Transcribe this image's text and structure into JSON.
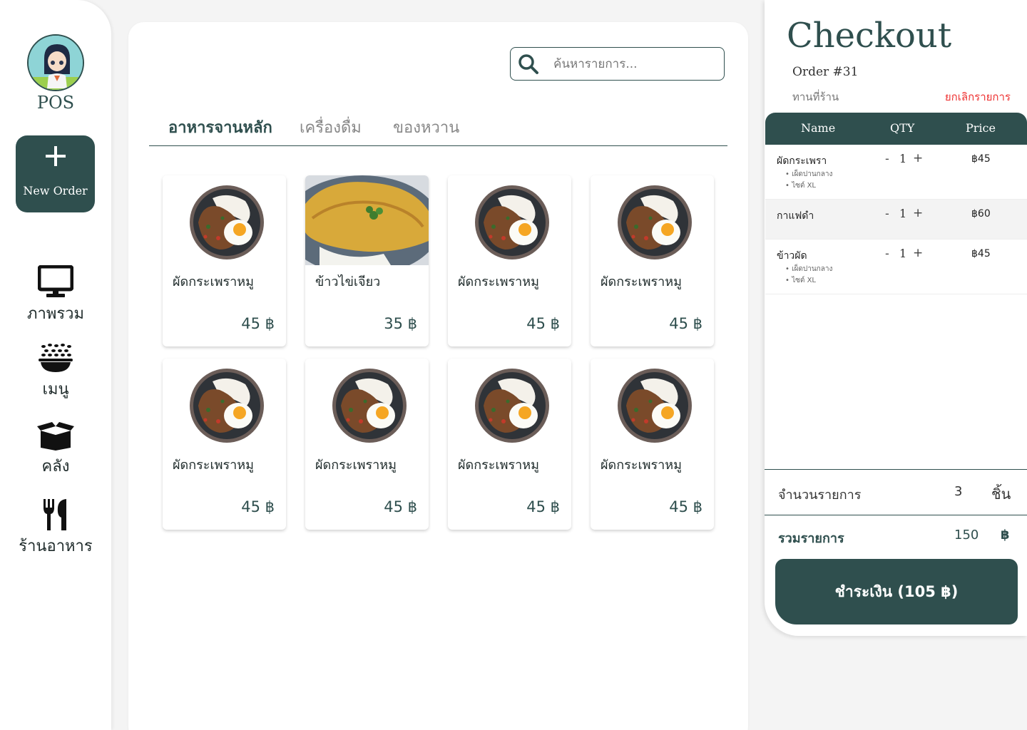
{
  "app": {
    "brand": "POS"
  },
  "sidebar": {
    "new_order_label": "New Order",
    "items": [
      {
        "label": "ภาพรวม",
        "icon": "monitor-icon"
      },
      {
        "label": "เมนู",
        "icon": "rice-bowl-icon"
      },
      {
        "label": "คลัง",
        "icon": "box-icon"
      },
      {
        "label": "ร้านอาหาร",
        "icon": "fork-knife-icon"
      }
    ]
  },
  "search": {
    "placeholder": "ค้นหารายการ..."
  },
  "tabs": [
    {
      "label": "อาหารจานหลัก",
      "active": true
    },
    {
      "label": "เครื่องดื่ม",
      "active": false
    },
    {
      "label": "ของหวาน",
      "active": false
    }
  ],
  "menu_items": [
    {
      "name": "ผัดกระเพราหมู",
      "price": "45 ฿",
      "image": "basil-pork-rice"
    },
    {
      "name": "ข้าวไข่เจียว",
      "price": "35 ฿",
      "image": "omelette-rice"
    },
    {
      "name": "ผัดกระเพราหมู",
      "price": "45 ฿",
      "image": "basil-pork-rice"
    },
    {
      "name": "ผัดกระเพราหมู",
      "price": "45 ฿",
      "image": "basil-pork-rice"
    },
    {
      "name": "ผัดกระเพราหมู",
      "price": "45 ฿",
      "image": "basil-pork-rice"
    },
    {
      "name": "ผัดกระเพราหมู",
      "price": "45 ฿",
      "image": "basil-pork-rice"
    },
    {
      "name": "ผัดกระเพราหมู",
      "price": "45 ฿",
      "image": "basil-pork-rice"
    },
    {
      "name": "ผัดกระเพราหมู",
      "price": "45 ฿",
      "image": "basil-pork-rice"
    }
  ],
  "checkout": {
    "title": "Checkout",
    "order_no": "Order #31",
    "dine_type": "ทานที่ร้าน",
    "cancel_label": "ยกเลิกรายการ",
    "columns": {
      "name": "Name",
      "qty": "QTY",
      "price": "Price"
    },
    "items": [
      {
        "name": "ผัดกระเพรา",
        "qty": "1",
        "price": "฿45",
        "options": [
          "เผ็ดปานกลาง",
          "ไซต์ XL"
        ]
      },
      {
        "name": "กาแฟดำ",
        "qty": "1",
        "price": "฿60",
        "options": []
      },
      {
        "name": "ข้าวผัด",
        "qty": "1",
        "price": "฿45",
        "options": [
          "เผ็ดปานกลาง",
          "ไซต์ XL"
        ]
      }
    ],
    "minus": "-",
    "plus": "+",
    "bullet": "•",
    "count_label": "จำนวนรายการ",
    "count_value": "3",
    "count_unit": "ชิ้น",
    "total_label": "รวมรายการ",
    "total_value": "150",
    "total_unit": "฿",
    "pay_label": "ชำระเงิน (105 ฿)"
  },
  "colors": {
    "primary": "#2f4f4e",
    "danger": "#e33333",
    "background": "#f4f4f4"
  }
}
